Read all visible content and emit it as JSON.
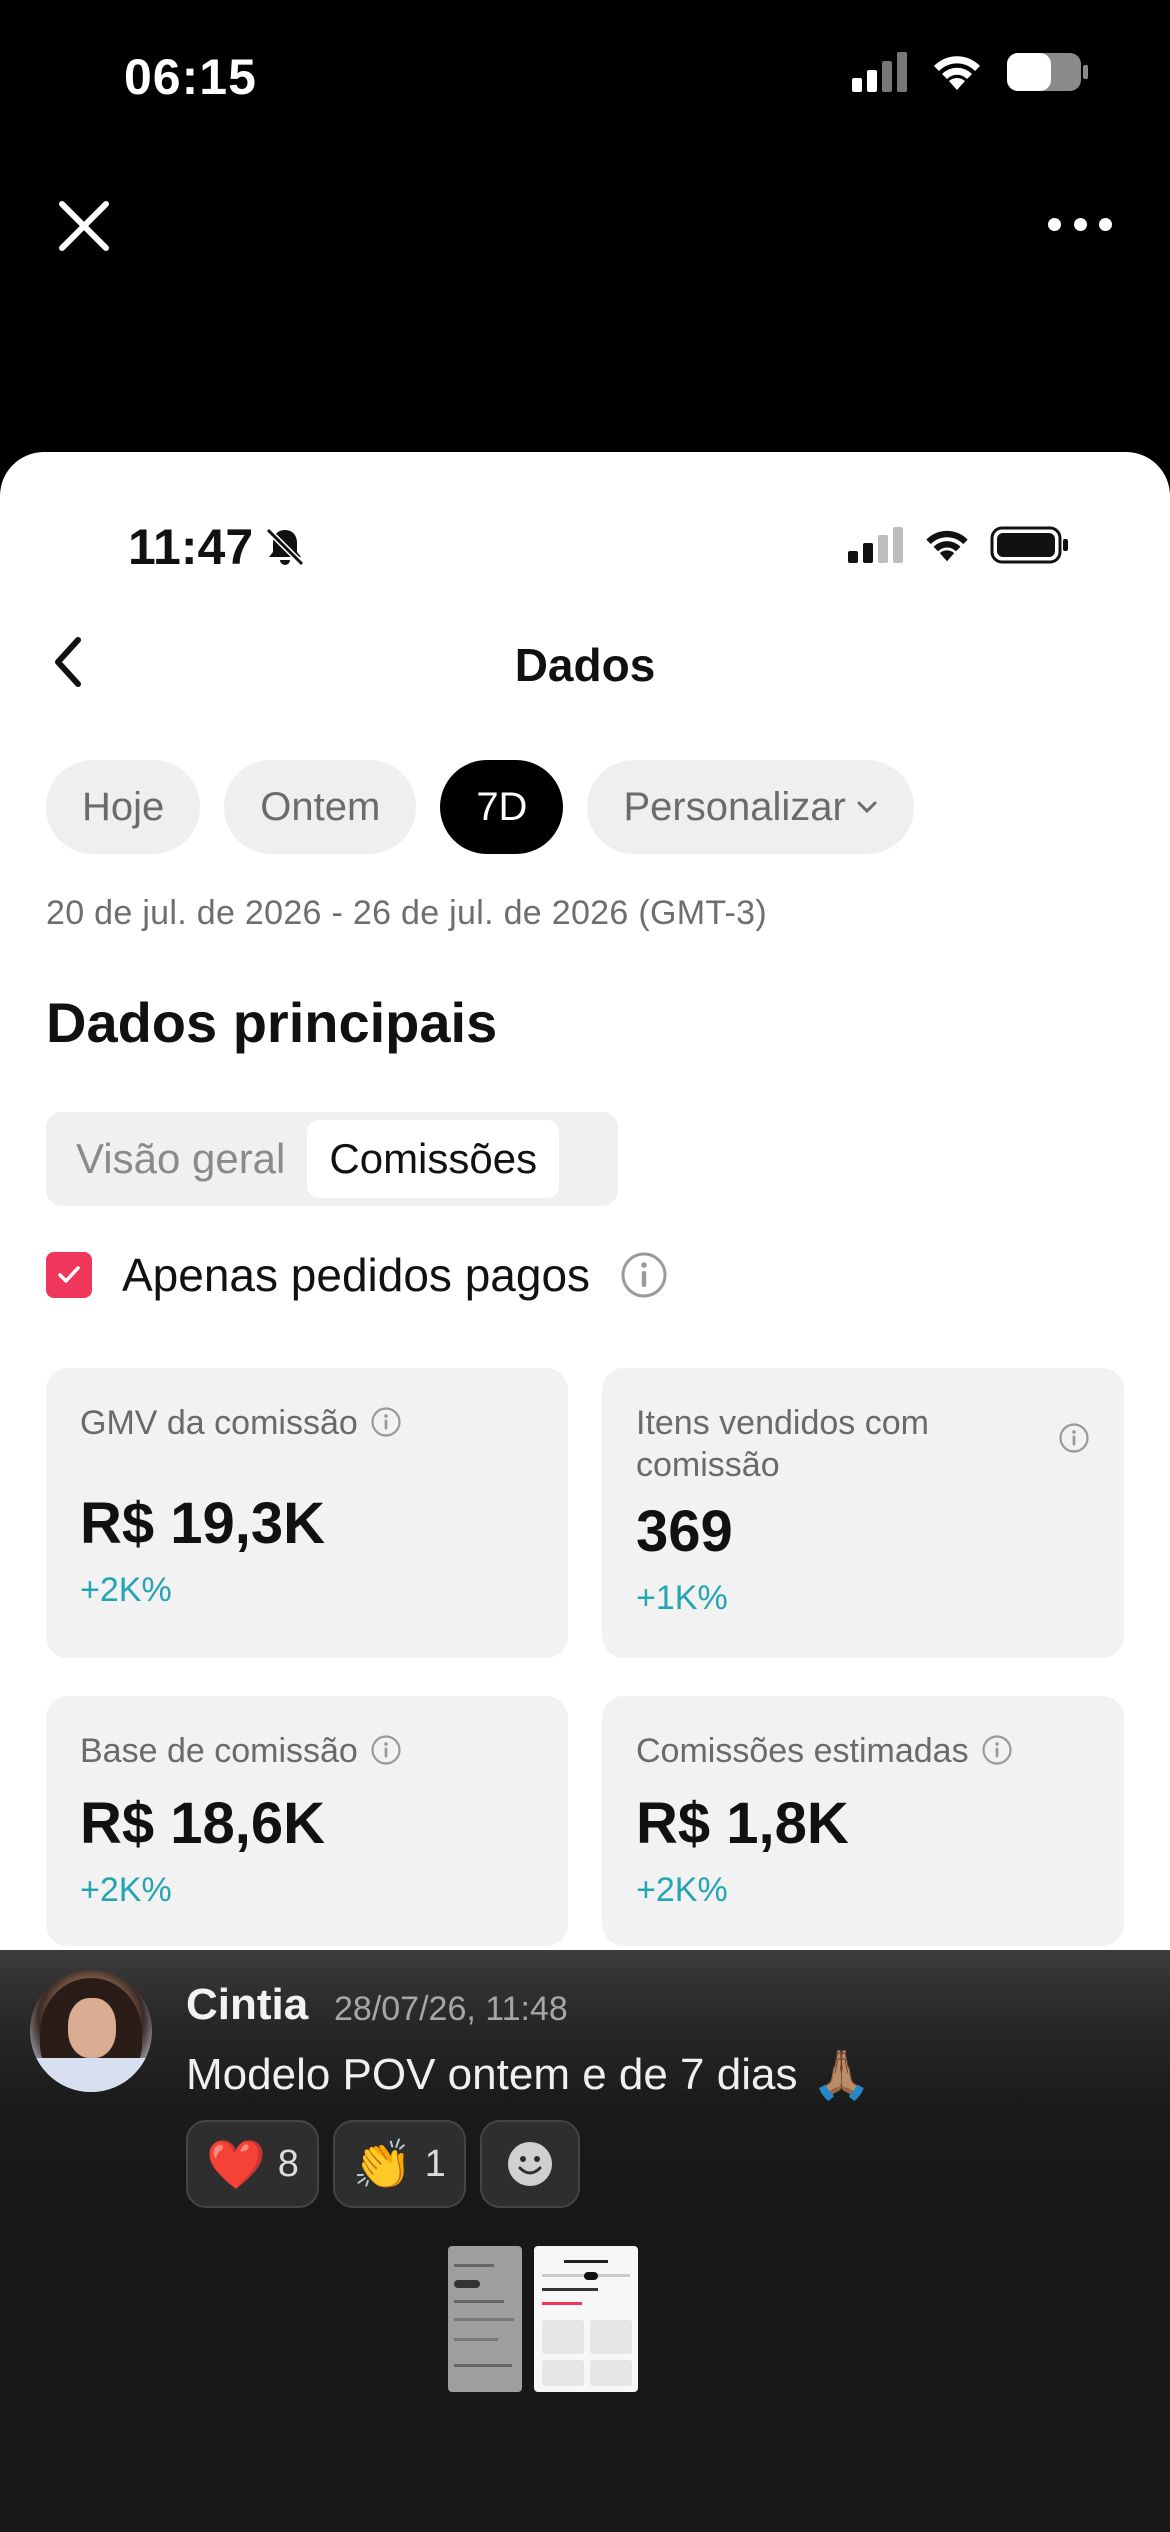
{
  "outer_status": {
    "time": "06:15"
  },
  "inner_status": {
    "time": "11:47"
  },
  "header": {
    "title": "Dados"
  },
  "chips": [
    {
      "label": "Hoje",
      "active": false
    },
    {
      "label": "Ontem",
      "active": false
    },
    {
      "label": "7D",
      "active": true
    },
    {
      "label": "Personalizar",
      "active": false,
      "has_caret": true
    }
  ],
  "date_range": "20 de jul. de 2026 - 26 de jul. de 2026 (GMT-3)",
  "section": {
    "title": "Dados principais"
  },
  "segmented": {
    "items": [
      "Visão geral",
      "Comissões"
    ],
    "active_index": 1
  },
  "filter": {
    "label": "Apenas pedidos pagos",
    "checked": true
  },
  "cards": [
    {
      "label": "GMV da comissão",
      "value": "R$ 19,3K",
      "delta": "+2K%"
    },
    {
      "label": "Itens vendidos com comissão",
      "value": "369",
      "delta": "+1K%"
    },
    {
      "label": "Base de comissão",
      "value": "R$ 18,6K",
      "delta": "+2K%"
    },
    {
      "label": "Comissões estimadas",
      "value": "R$ 1,8K",
      "delta": "+2K%"
    }
  ],
  "chat": {
    "name": "Cintia",
    "timestamp": "28/07/26, 11:48",
    "message": "Modelo POV ontem e de 7 dias",
    "message_emoji": "🙏🏽",
    "reactions": [
      {
        "emoji": "❤️",
        "count": "8"
      },
      {
        "emoji": "👏",
        "count": "1"
      }
    ]
  },
  "colors": {
    "accent_checkbox": "#f0365b",
    "delta_text": "#25a5b3",
    "chip_active": "#000000"
  }
}
